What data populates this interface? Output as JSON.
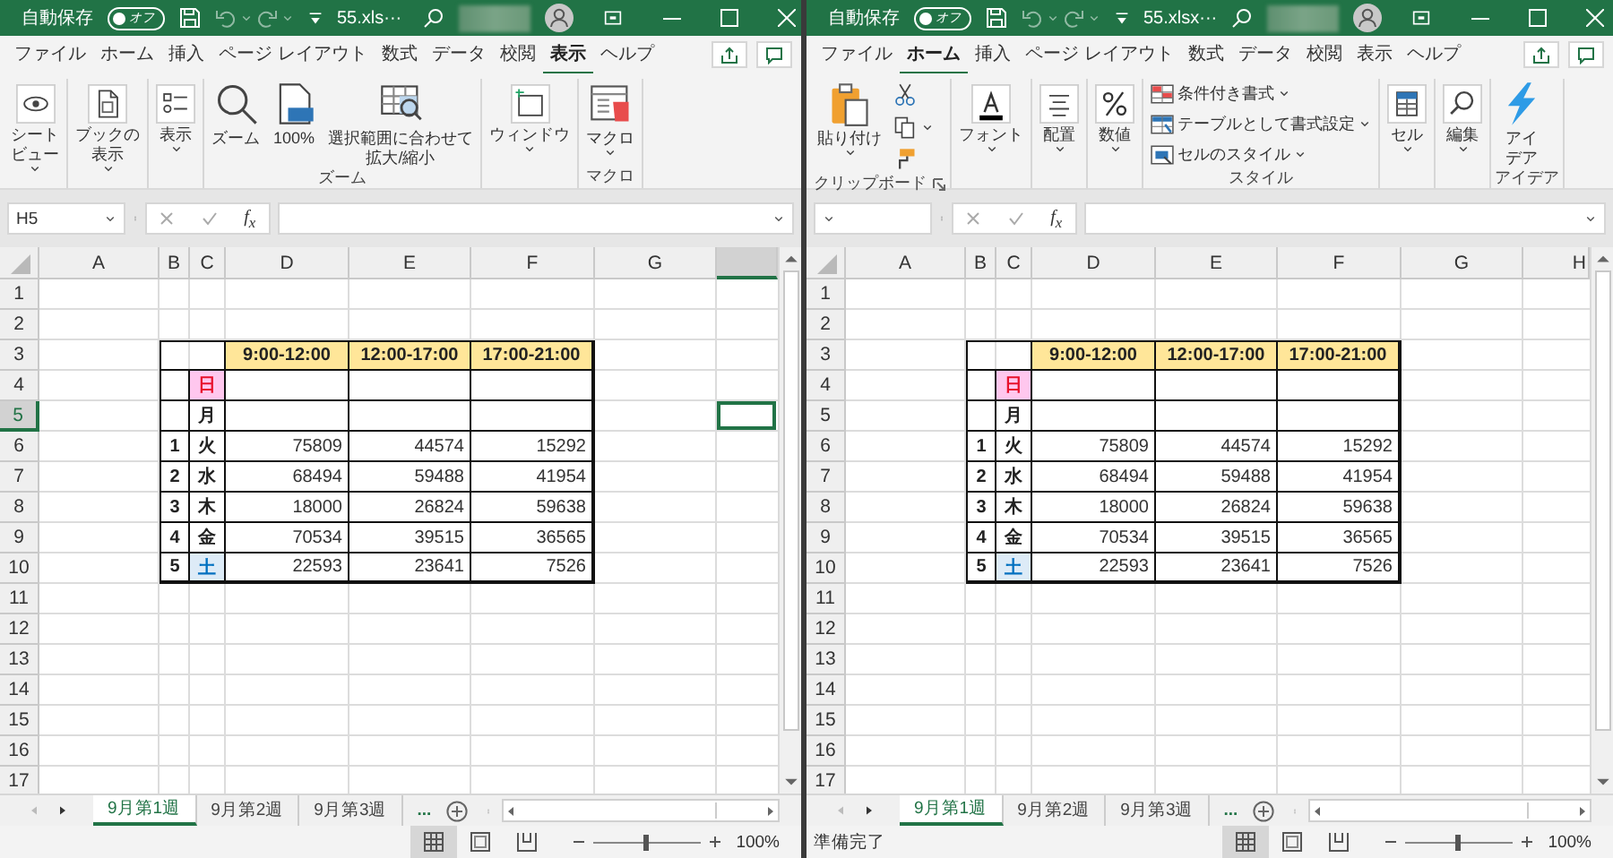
{
  "windows": [
    {
      "title_bar": {
        "autosave_label": "自動保存",
        "autosave_toggle": {
          "label": "オフ",
          "on": false
        },
        "file_name": "55.xls···"
      },
      "ribbon_tabs": [
        {
          "label": "ファイル",
          "selected": false
        },
        {
          "label": "ホーム",
          "selected": false
        },
        {
          "label": "挿入",
          "selected": false
        },
        {
          "label": "ページ レイアウト",
          "selected": false
        },
        {
          "label": "数式",
          "selected": false
        },
        {
          "label": "データ",
          "selected": false
        },
        {
          "label": "校閲",
          "selected": false
        },
        {
          "label": "表示",
          "selected": true
        },
        {
          "label": "ヘルプ",
          "selected": false
        }
      ],
      "ribbon_groups": [
        {
          "items": [
            {
              "kind": "collapsed",
              "lines": [
                "シート",
                "ビュー"
              ],
              "dropdown": true
            }
          ]
        },
        {
          "items": [
            {
              "kind": "collapsed",
              "lines": [
                "ブックの",
                "表示"
              ],
              "dropdown": true
            }
          ]
        },
        {
          "items": [
            {
              "kind": "collapsed",
              "text": "表示",
              "dropdown": true
            }
          ]
        },
        {
          "label": "ズーム",
          "items": [
            {
              "kind": "large",
              "text": "ズーム"
            },
            {
              "kind": "large",
              "text": "100%"
            },
            {
              "kind": "large",
              "lines": [
                "選択範囲に合わせて",
                "拡大/縮小"
              ]
            }
          ]
        },
        {
          "items": [
            {
              "kind": "collapsed",
              "text": "ウィンドウ",
              "dropdown": true
            }
          ]
        },
        {
          "label": "マクロ",
          "items": [
            {
              "kind": "large",
              "text": "マクロ",
              "dropdown": true
            }
          ]
        }
      ],
      "formula_bar": {
        "name_box": "H5",
        "function_label": "f$_{x}$"
      },
      "sheet": {
        "columns": [
          {
            "label": "A",
            "selected": false
          },
          {
            "label": "B",
            "selected": false
          },
          {
            "label": "C",
            "selected": false
          },
          {
            "label": "D",
            "selected": false
          },
          {
            "label": "E",
            "selected": false
          },
          {
            "label": "F",
            "selected": false
          },
          {
            "label": "G",
            "selected": false
          },
          {
            "selected": true
          }
        ],
        "rows": [
          {
            "label": "1",
            "selected": false
          },
          {
            "label": "2",
            "selected": false
          },
          {
            "label": "3",
            "selected": false
          },
          {
            "label": "4",
            "selected": false
          },
          {
            "label": "5",
            "selected": true
          },
          {
            "label": "6",
            "selected": false
          },
          {
            "label": "7",
            "selected": false
          },
          {
            "label": "8",
            "selected": false
          },
          {
            "label": "9",
            "selected": false
          },
          {
            "label": "10",
            "selected": false
          },
          {
            "label": "11",
            "selected": false
          },
          {
            "label": "12",
            "selected": false
          },
          {
            "label": "13",
            "selected": false
          },
          {
            "label": "14",
            "selected": false
          },
          {
            "label": "15",
            "selected": false
          },
          {
            "label": "16",
            "selected": false
          },
          {
            "label": "17",
            "selected": false
          }
        ],
        "table": {
          "header": [
            "9:00-12:00",
            "12:00-17:00",
            "17:00-21:00"
          ],
          "rows": [
            {
              "day": "日",
              "kind": "sunday"
            },
            {
              "day": "月",
              "kind": "weekday"
            },
            {
              "number": "1",
              "day": "火",
              "kind": "weekday",
              "values": [
                "75809",
                "44574",
                "15292"
              ]
            },
            {
              "number": "2",
              "day": "水",
              "kind": "weekday",
              "values": [
                "68494",
                "59488",
                "41954"
              ]
            },
            {
              "number": "3",
              "day": "木",
              "kind": "weekday",
              "values": [
                "18000",
                "26824",
                "59638"
              ]
            },
            {
              "number": "4",
              "day": "金",
              "kind": "weekday",
              "values": [
                "70534",
                "39515",
                "36565"
              ]
            },
            {
              "number": "5",
              "day": "土",
              "kind": "saturday",
              "values": [
                "22593",
                "23641",
                "7526"
              ]
            }
          ]
        }
      },
      "sheet_tabs": [
        {
          "label": "9月第1週",
          "selected": true
        },
        {
          "label": "9月第2週",
          "selected": false
        },
        {
          "label": "9月第3週",
          "selected": false
        }
      ],
      "more_tabs": "...",
      "status_bar": {
        "views": [
          {
            "selected": true
          },
          {
            "selected": false
          },
          {
            "selected": false
          }
        ],
        "zoom": {
          "level": 0.5,
          "reading": "100%"
        }
      }
    },
    {
      "title_bar": {
        "autosave_label": "自動保存",
        "autosave_toggle": {
          "label": "オフ",
          "on": false
        },
        "file_name": "55.xlsx···"
      },
      "ribbon_tabs": [
        {
          "label": "ファイル",
          "selected": false
        },
        {
          "label": "ホーム",
          "selected": true
        },
        {
          "label": "挿入",
          "selected": false
        },
        {
          "label": "ページ レイアウト",
          "selected": false
        },
        {
          "label": "数式",
          "selected": false
        },
        {
          "label": "データ",
          "selected": false
        },
        {
          "label": "校閲",
          "selected": false
        },
        {
          "label": "表示",
          "selected": false
        },
        {
          "label": "ヘルプ",
          "selected": false
        }
      ],
      "ribbon_groups": [
        {
          "label": "クリップボード",
          "launcher": true,
          "items": [
            {
              "kind": "large",
              "text": "貼り付け",
              "dropdown": true
            },
            {
              "kind": "icon"
            },
            {
              "kind": "icon",
              "dropdown": true
            },
            {
              "kind": "icon"
            }
          ]
        },
        {
          "items": [
            {
              "kind": "collapsed",
              "text": "フォント",
              "dropdown": true
            }
          ]
        },
        {
          "items": [
            {
              "kind": "collapsed",
              "text": "配置",
              "dropdown": true
            }
          ]
        },
        {
          "items": [
            {
              "kind": "collapsed",
              "text": "数値",
              "dropdown": true
            }
          ]
        },
        {
          "label": "スタイル",
          "items": [
            {
              "kind": "small",
              "text": "条件付き書式",
              "dropdown": true
            },
            {
              "kind": "small",
              "text": "テーブルとして書式設定",
              "dropdown": true
            },
            {
              "kind": "small",
              "text": "セルのスタイル",
              "dropdown": true
            }
          ]
        },
        {
          "items": [
            {
              "kind": "collapsed",
              "text": "セル",
              "dropdown": true
            }
          ]
        },
        {
          "items": [
            {
              "kind": "collapsed",
              "text": "編集",
              "dropdown": true
            }
          ]
        },
        {
          "label": "アイデア",
          "items": [
            {
              "kind": "large",
              "lines": [
                "アイ",
                "デア"
              ]
            }
          ]
        }
      ],
      "formula_bar": {
        "function_label": "f$_{x}$"
      },
      "sheet": {
        "columns": [
          {
            "label": "A",
            "selected": false
          },
          {
            "label": "B",
            "selected": false
          },
          {
            "label": "C",
            "selected": false
          },
          {
            "label": "D",
            "selected": false
          },
          {
            "label": "E",
            "selected": false
          },
          {
            "label": "F",
            "selected": false
          },
          {
            "label": "G",
            "selected": false
          },
          {
            "label": "H",
            "selected": false
          }
        ],
        "rows": [
          {
            "label": "1",
            "selected": false
          },
          {
            "label": "2",
            "selected": false
          },
          {
            "label": "3",
            "selected": false
          },
          {
            "label": "4",
            "selected": false
          },
          {
            "label": "5",
            "selected": false
          },
          {
            "label": "6",
            "selected": false
          },
          {
            "label": "7",
            "selected": false
          },
          {
            "label": "8",
            "selected": false
          },
          {
            "label": "9",
            "selected": false
          },
          {
            "label": "10",
            "selected": false
          },
          {
            "label": "11",
            "selected": false
          },
          {
            "label": "12",
            "selected": false
          },
          {
            "label": "13",
            "selected": false
          },
          {
            "label": "14",
            "selected": false
          },
          {
            "label": "15",
            "selected": false
          },
          {
            "label": "16",
            "selected": false
          },
          {
            "label": "17",
            "selected": false
          }
        ],
        "table": {
          "header": [
            "9:00-12:00",
            "12:00-17:00",
            "17:00-21:00"
          ],
          "rows": [
            {
              "day": "日",
              "kind": "sunday"
            },
            {
              "day": "月",
              "kind": "weekday"
            },
            {
              "number": "1",
              "day": "火",
              "kind": "weekday",
              "values": [
                "75809",
                "44574",
                "15292"
              ]
            },
            {
              "number": "2",
              "day": "水",
              "kind": "weekday",
              "values": [
                "68494",
                "59488",
                "41954"
              ]
            },
            {
              "number": "3",
              "day": "木",
              "kind": "weekday",
              "values": [
                "18000",
                "26824",
                "59638"
              ]
            },
            {
              "number": "4",
              "day": "金",
              "kind": "weekday",
              "values": [
                "70534",
                "39515",
                "36565"
              ]
            },
            {
              "number": "5",
              "day": "土",
              "kind": "saturday",
              "values": [
                "22593",
                "23641",
                "7526"
              ]
            }
          ]
        }
      },
      "sheet_tabs": [
        {
          "label": "9月第1週",
          "selected": true
        },
        {
          "label": "9月第2週",
          "selected": false
        },
        {
          "label": "9月第3週",
          "selected": false
        }
      ],
      "more_tabs": "...",
      "status_bar": {
        "status_text": "準備完了",
        "views": [
          {
            "selected": true
          },
          {
            "selected": false
          },
          {
            "selected": false
          }
        ],
        "zoom": {
          "level": 0.5,
          "reading": "100%"
        }
      }
    }
  ]
}
